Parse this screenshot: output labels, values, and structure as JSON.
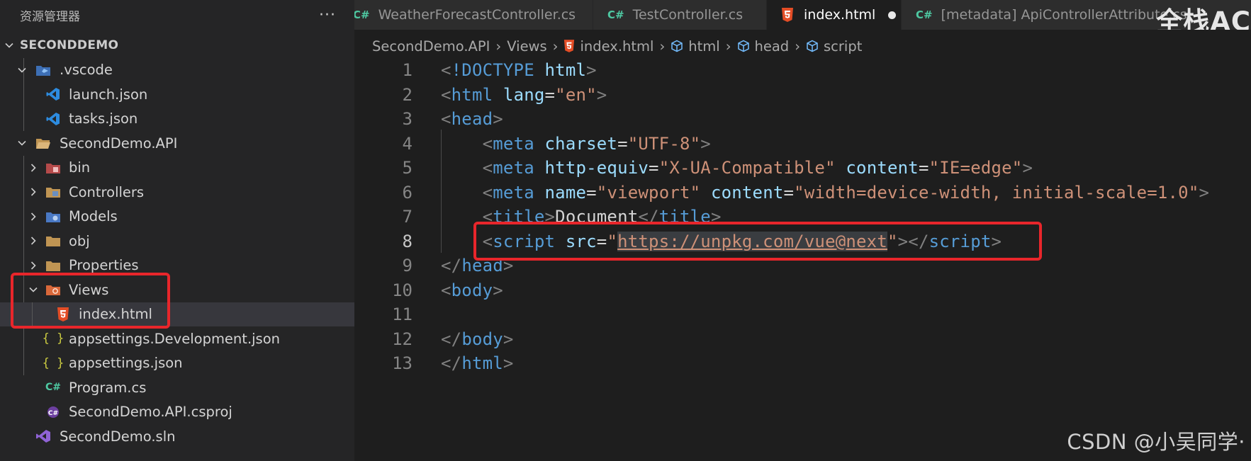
{
  "sidebar": {
    "title": "资源管理器",
    "more_label": "···",
    "tree": [
      {
        "label": "SECONDDEMO",
        "depth": 0,
        "type": "root",
        "expanded": true,
        "icon": "chevron-down-icon"
      },
      {
        "label": ".vscode",
        "depth": 1,
        "type": "folder-vscode-icon",
        "expanded": true
      },
      {
        "label": "launch.json",
        "depth": 2,
        "type": "vscode-file-icon"
      },
      {
        "label": "tasks.json",
        "depth": 2,
        "type": "vscode-file-icon"
      },
      {
        "label": "SecondDemo.API",
        "depth": 1,
        "type": "folder-icon",
        "expanded": true
      },
      {
        "label": "bin",
        "depth": 2,
        "type": "folder-bin-icon",
        "expanded": false
      },
      {
        "label": "Controllers",
        "depth": 2,
        "type": "folder-controllers-icon",
        "expanded": false
      },
      {
        "label": "Models",
        "depth": 2,
        "type": "folder-models-icon",
        "expanded": false
      },
      {
        "label": "obj",
        "depth": 2,
        "type": "folder-icon",
        "expanded": false
      },
      {
        "label": "Properties",
        "depth": 2,
        "type": "folder-icon",
        "expanded": false
      },
      {
        "label": "Views",
        "depth": 2,
        "type": "folder-views-icon",
        "expanded": true
      },
      {
        "label": "index.html",
        "depth": 3,
        "type": "html5-icon",
        "selected": true
      },
      {
        "label": "appsettings.Development.json",
        "depth": 2,
        "type": "json-braces-icon"
      },
      {
        "label": "appsettings.json",
        "depth": 2,
        "type": "json-braces-icon"
      },
      {
        "label": "Program.cs",
        "depth": 2,
        "type": "csharp-icon"
      },
      {
        "label": "SecondDemo.API.csproj",
        "depth": 2,
        "type": "csproj-icon"
      },
      {
        "label": "SecondDemo.sln",
        "depth": 1,
        "type": "visual-studio-icon"
      }
    ]
  },
  "tabs": [
    {
      "label": "WeatherForecastController.cs",
      "icon": "C#",
      "active": false
    },
    {
      "label": "TestController.cs",
      "icon": "C#",
      "active": false
    },
    {
      "label": "index.html",
      "icon": "html5-icon",
      "active": true,
      "modified": true
    },
    {
      "label": "[metadata] ApiControllerAttribute.cs",
      "icon": "C#",
      "active": false
    }
  ],
  "breadcrumb": [
    "SecondDemo.API",
    "Views",
    "index.html",
    "html",
    "head",
    "script"
  ],
  "editor": {
    "lines": [
      {
        "n": "1"
      },
      {
        "n": "2"
      },
      {
        "n": "3"
      },
      {
        "n": "4"
      },
      {
        "n": "5"
      },
      {
        "n": "6"
      },
      {
        "n": "7"
      },
      {
        "n": "8"
      },
      {
        "n": "9"
      },
      {
        "n": "10"
      },
      {
        "n": "11"
      },
      {
        "n": "12"
      },
      {
        "n": "13"
      }
    ],
    "tokens": {
      "lt": "<",
      "gt": ">",
      "lts": "</",
      "eq": "=",
      "doctype_kw": "!DOCTYPE",
      "html": "html",
      "head": "head",
      "meta": "meta",
      "title": "title",
      "script": "script",
      "body": "body",
      "lang": "lang",
      "lang_val": "\"en\"",
      "charset": "charset",
      "charset_val": "\"UTF-8\"",
      "http_equiv": "http-equiv",
      "http_equiv_val": "\"X-UA-Compatible\"",
      "content": "content",
      "content_val1": "\"IE=edge\"",
      "name": "name",
      "name_val": "\"viewport\"",
      "content_val2": "\"width=device-width, initial-scale=1.0\"",
      "title_text": "Document",
      "src": "src",
      "quote": "\"",
      "url": "https://unpkg.com/vue@next"
    }
  },
  "watermarks": {
    "top_right": "全栈AC",
    "bottom_right": "CSDN @小吴同学·"
  },
  "colors": {
    "annotation": "#e8262b",
    "tag": "#569cd6",
    "attribute": "#9cdcfe",
    "string": "#ce9178",
    "html5_orange": "#e44d26",
    "csharp": "#4ec9a2"
  }
}
